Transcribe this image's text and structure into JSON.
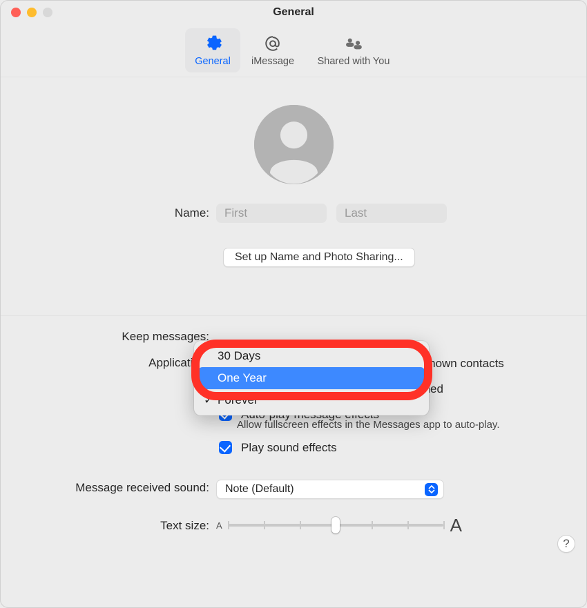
{
  "window": {
    "title": "General"
  },
  "tabs": {
    "general": "General",
    "imessage": "iMessage",
    "shared": "Shared with You"
  },
  "labels": {
    "name": "Name:",
    "keep": "Keep messages:",
    "application": "Application:",
    "sound": "Message received sound:",
    "textsize": "Text size:"
  },
  "name": {
    "first_placeholder": "First",
    "last_placeholder": "Last",
    "first_value": "",
    "last_value": ""
  },
  "photo_btn": "Set up Name and Photo Sharing...",
  "keep_menu": {
    "options": [
      "30 Days",
      "One Year",
      "Forever"
    ],
    "highlighted": "One Year",
    "checked": "Forever"
  },
  "app_options": {
    "notify_unknown": "Notify me about messages from unknown contacts",
    "notify_mention": "Notify me when my name is mentioned",
    "autoplay": "Auto-play message effects",
    "autoplay_sub": "Allow fullscreen effects in the Messages app to auto-play.",
    "sound_fx": "Play sound effects"
  },
  "sound_popup": "Note (Default)",
  "text_size": {
    "small_marker": "A",
    "big_marker": "A",
    "value_percent": 50,
    "ticks": 7
  },
  "help": "?"
}
